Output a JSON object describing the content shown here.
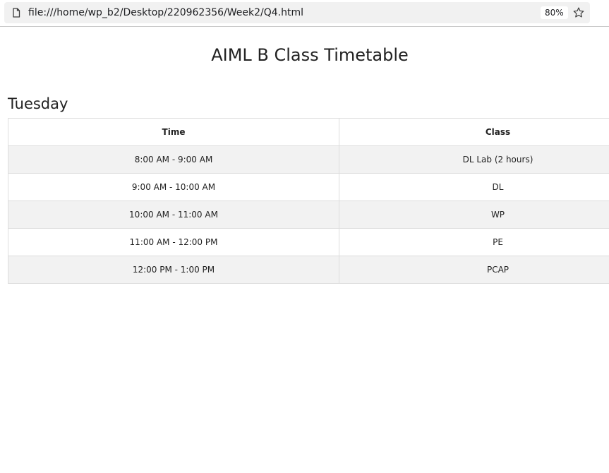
{
  "browser": {
    "url": "file:///home/wp_b2/Desktop/220962356/Week2/Q4.html",
    "zoom": "80%",
    "page_icon": "page-icon",
    "bookmark_icon": "star-icon"
  },
  "page": {
    "title": "AIML B Class Timetable",
    "day": "Tuesday",
    "table": {
      "headers": [
        "Time",
        "Class"
      ],
      "rows": [
        [
          "8:00 AM - 9:00 AM",
          "DL Lab (2 hours)"
        ],
        [
          "9:00 AM - 10:00 AM",
          "DL"
        ],
        [
          "10:00 AM - 11:00 AM",
          "WP"
        ],
        [
          "11:00 AM - 12:00 PM",
          "PE"
        ],
        [
          "12:00 PM - 1:00 PM",
          "PCAP"
        ]
      ]
    }
  }
}
